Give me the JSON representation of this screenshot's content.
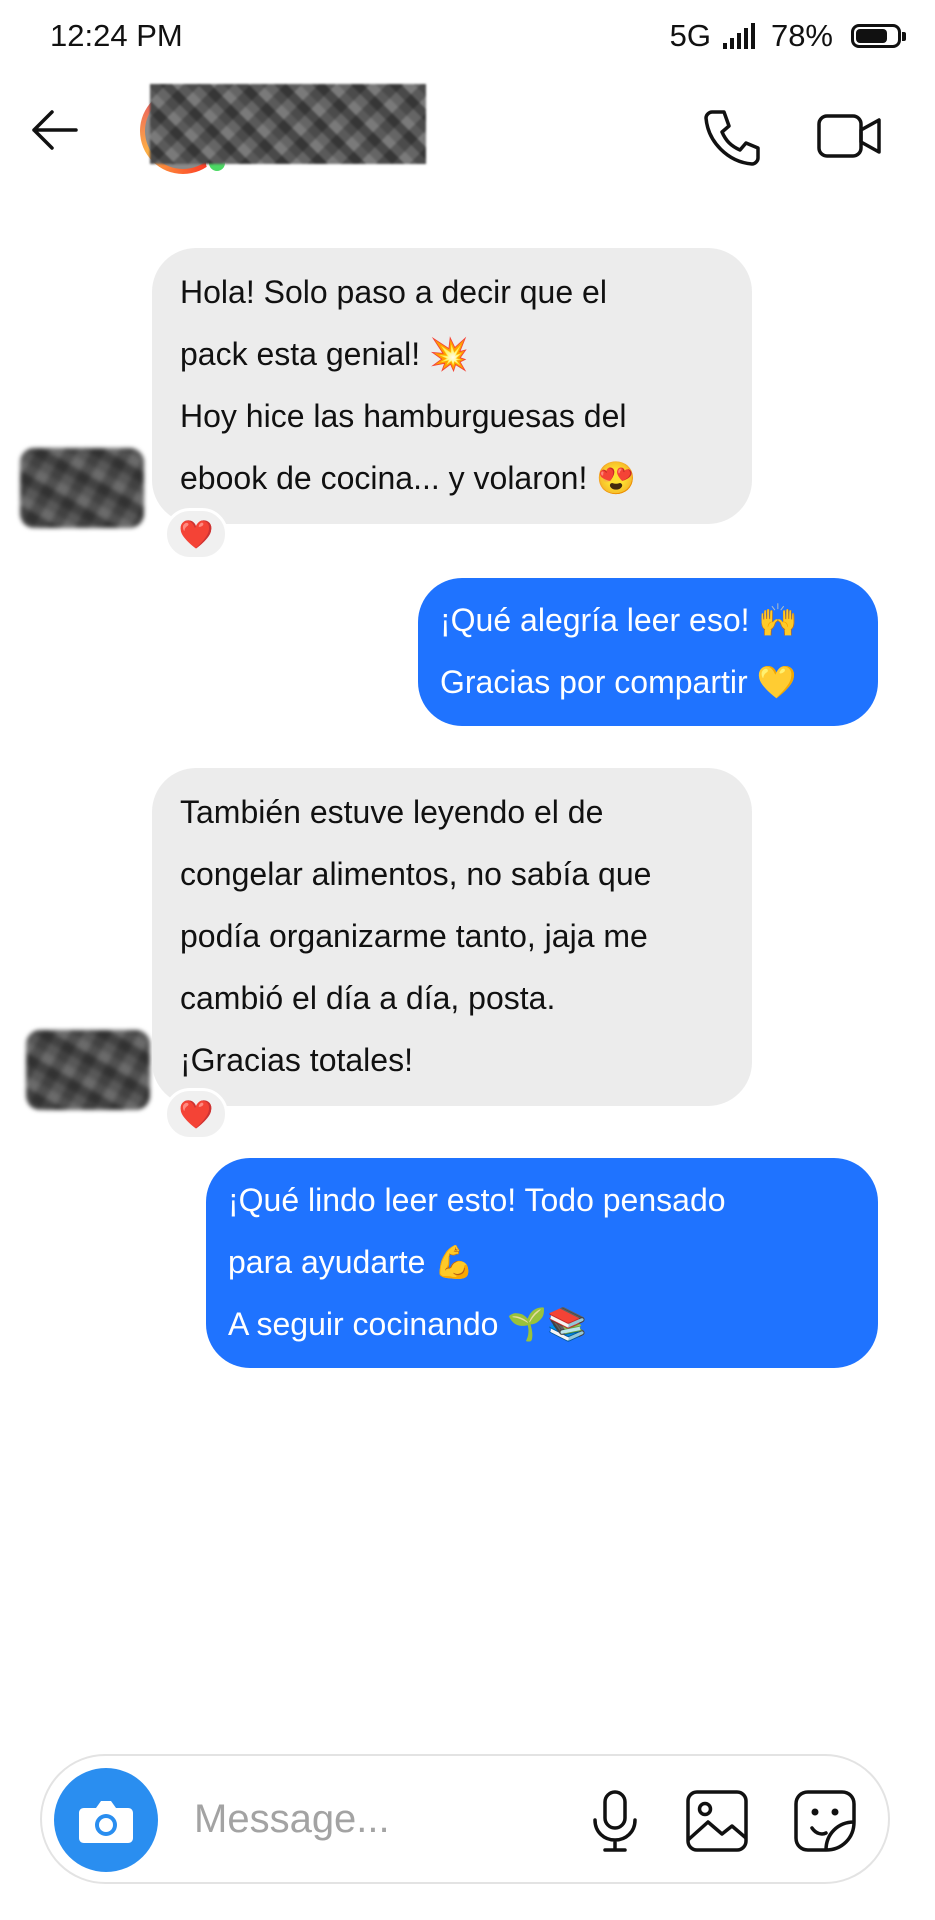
{
  "status_bar": {
    "time": "12:24 PM",
    "network": "5G",
    "battery": "78%",
    "battery_level": 0.78
  },
  "header": {
    "contact_name": ""
  },
  "messages": [
    {
      "direction": "incoming",
      "lines": [
        "Hola! Solo paso a decir que el",
        "pack esta genial! 💥",
        "Hoy hice las hamburguesas del",
        "ebook de cocina... y volaron! 😍"
      ],
      "reaction": "❤️"
    },
    {
      "direction": "outgoing",
      "lines": [
        "¡Qué alegría leer eso! 🙌",
        "Gracias por compartir 💛"
      ]
    },
    {
      "direction": "incoming",
      "lines": [
        "También estuve leyendo el de",
        "congelar alimentos, no sabía que",
        "podía organizarme tanto, jaja me",
        "cambió el día a día, posta.",
        "¡Gracias totales!"
      ],
      "reaction": "❤️"
    },
    {
      "direction": "outgoing",
      "lines": [
        "¡Qué lindo leer esto! Todo pensado",
        "para ayudarte 💪",
        "A seguir cocinando 🌱📚"
      ]
    }
  ],
  "composer": {
    "placeholder": "Message..."
  },
  "colors": {
    "outgoing_bubble": "#1f73ff",
    "incoming_bubble": "#ececec",
    "camera_button": "#2a8ef0"
  }
}
